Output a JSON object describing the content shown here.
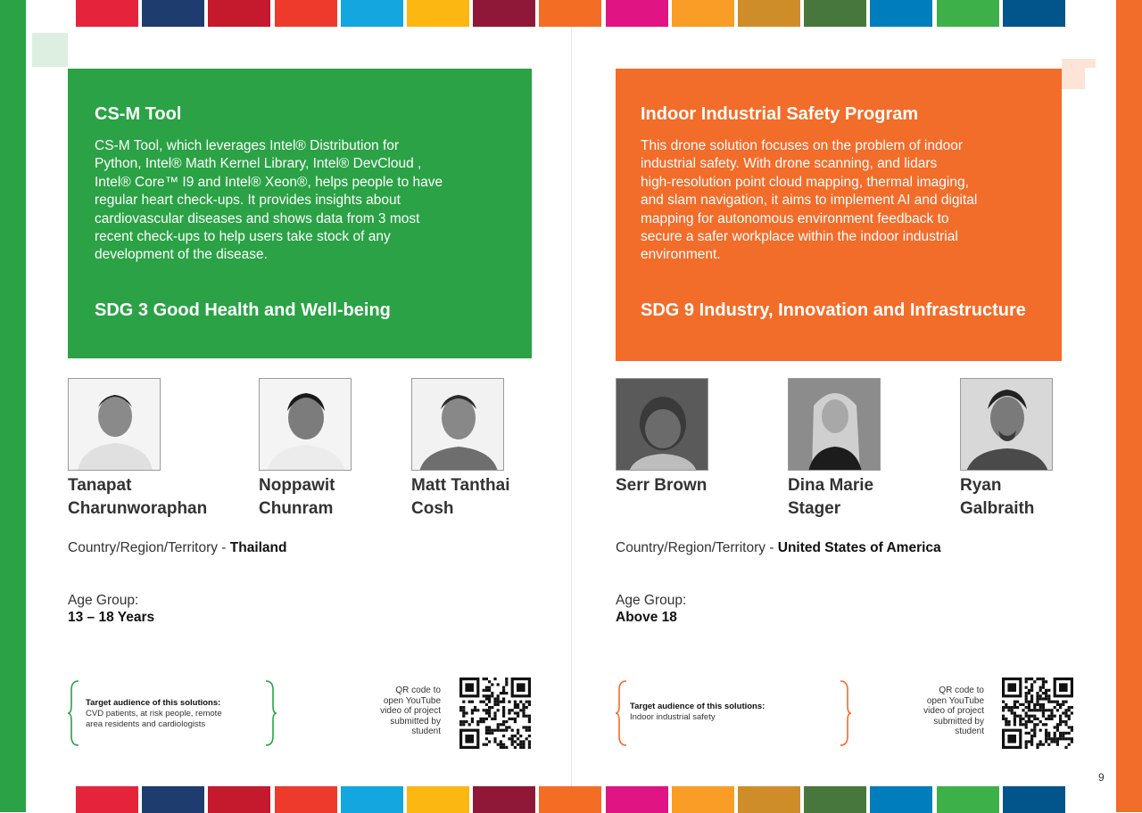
{
  "colors": {
    "left_border": "#2aa245",
    "right_border": "#f26c2a",
    "sdg_stripes": [
      "#e5243b",
      "#1f3c6e",
      "#c5192d",
      "#ee3a2d",
      "#13a6df",
      "#fdb713",
      "#8f1838",
      "#f36d25",
      "#e11484",
      "#f99d26",
      "#cf8d2a",
      "#48773e",
      "#007dbc",
      "#3eb049",
      "#02558b"
    ],
    "card_left": "#2aa245",
    "card_right": "#f26c2a",
    "deco_left": "#dcefe0",
    "deco_right": "#fde4d6",
    "brace_left": "#2aa245",
    "brace_right": "#f26c2a"
  },
  "left": {
    "card": {
      "title": "CS-M Tool",
      "description_lines": [
        "CS-M Tool, which leverages Intel® Distribution for",
        "Python, Intel® Math Kernel Library, Intel® DevCloud ,",
        "Intel® Core™ I9 and Intel® Xeon®, helps people to have",
        "regular heart check-ups. It provides insights about",
        "cardiovascular diseases and shows data from 3 most",
        "recent check-ups to help users take stock of any",
        "development of the disease."
      ],
      "sdg": "SDG 3 Good Health and Well-being"
    },
    "members": [
      {
        "name_lines": [
          "Tanapat",
          "Charunworaphan"
        ]
      },
      {
        "name_lines": [
          "Noppawit",
          "Chunram"
        ]
      },
      {
        "name_lines": [
          "Matt Tanthai",
          "Cosh"
        ]
      }
    ],
    "country_label": "Country/Region/Territory - ",
    "country_value": "Thailand",
    "age_label": "Age Group:",
    "age_value": "13 – 18 Years",
    "target_label": "Target audience of this solutions:",
    "target_value_lines": [
      "CVD patients, at risk people, remote",
      "area residents and cardiologists"
    ],
    "qr_text_lines": [
      "QR code to",
      "open YouTube",
      "video of project",
      "submitted by",
      "student"
    ]
  },
  "right": {
    "card": {
      "title": "Indoor Industrial Safety Program",
      "description_lines": [
        "This drone solution focuses on the problem of indoor",
        "industrial safety. With drone scanning, and lidars",
        "high-resolution point cloud mapping, thermal imaging,",
        "and slam navigation, it aims to implement AI and digital",
        "mapping for autonomous environment feedback to",
        "secure a safer workplace within the indoor industrial",
        "environment."
      ],
      "sdg": "SDG 9 Industry, Innovation and Infrastructure"
    },
    "members": [
      {
        "name_lines": [
          "Serr Brown"
        ]
      },
      {
        "name_lines": [
          "Dina Marie",
          "Stager"
        ]
      },
      {
        "name_lines": [
          "Ryan",
          "Galbraith"
        ]
      }
    ],
    "country_label": "Country/Region/Territory - ",
    "country_value": "United States of America",
    "age_label": "Age Group:",
    "age_value": "Above 18",
    "target_label": "Target audience of this solutions:",
    "target_value_lines": [
      "Indoor industrial safety"
    ],
    "qr_text_lines": [
      "QR code to",
      "open YouTube",
      "video of project",
      "submitted by",
      "student"
    ],
    "page_number": "9"
  }
}
